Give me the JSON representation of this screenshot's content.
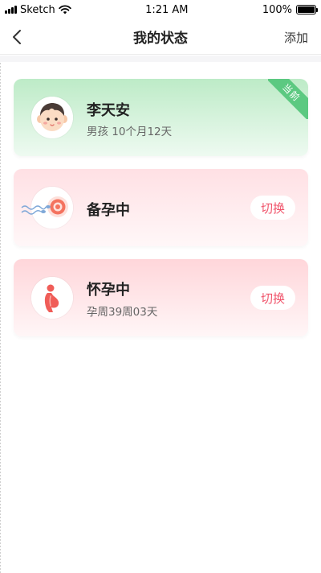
{
  "status_bar": {
    "carrier": "Sketch",
    "time": "1:21 AM",
    "battery": "100%",
    "battery_level": 1.0
  },
  "nav": {
    "title": "我的状态",
    "action": "添加"
  },
  "cards": [
    {
      "name": "李天安",
      "detail": "男孩   10个月12天",
      "badge": "当前",
      "avatar_icon": "baby-face-icon",
      "current": true
    },
    {
      "name": "备孕中",
      "button": "切换",
      "avatar_icon": "sperm-egg-icon"
    },
    {
      "name": "怀孕中",
      "detail": "孕周39周03天",
      "button": "切换",
      "avatar_icon": "pregnant-woman-icon"
    }
  ],
  "colors": {
    "accent": "#f0546b",
    "current_badge": "#5cc981",
    "green_card": "#bdebc7",
    "pink_card": "#ffe0e4"
  }
}
